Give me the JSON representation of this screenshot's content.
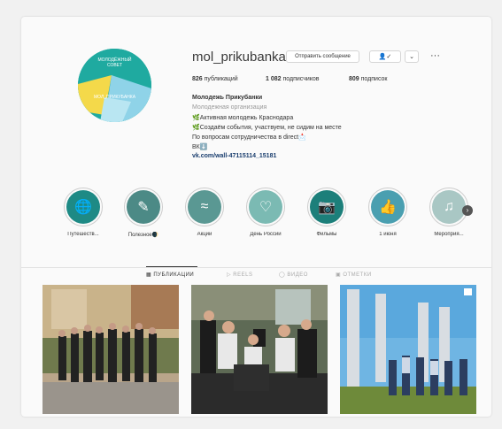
{
  "profile": {
    "avatar_text_line1": "МОЛОДЁЖНЫЙ",
    "avatar_text_line2": "СОВЕТ",
    "avatar_text_line3": "МОЛ_ПРИКУБАНКА",
    "username": "mol_prikubanka",
    "message_button": "Отправить сообщение",
    "follow_icon": "person-check-icon",
    "dropdown_icon": "chevron-down-icon",
    "more_icon": "more-icon"
  },
  "stats": {
    "posts_count": "826",
    "posts_label": "публикаций",
    "followers_count": "1 082",
    "followers_label": "подписчиков",
    "following_count": "809",
    "following_label": "подписок"
  },
  "bio": {
    "name": "Молодежь Прикубанки",
    "category": "Молодежная организация",
    "line1": "🌿Активная молодежь Краснодара",
    "line2": "🌿Создаём события, участвуем, не сидим на месте",
    "line3": "По вопросам сотрудничества в direct📩",
    "line4": "ВК⬇️",
    "link": "vk.com/wall-47115114_15181"
  },
  "highlights": [
    {
      "label": "Путешеств...",
      "icon": "globe-icon",
      "color": "#1e8a85"
    },
    {
      "label": "Полезное🌒",
      "icon": "pencil-icon",
      "color": "#4c8a86"
    },
    {
      "label": "Акции",
      "icon": "waves-icon",
      "color": "#5a9893"
    },
    {
      "label": "День России",
      "icon": "heart-icon",
      "color": "#7bbab3"
    },
    {
      "label": "Фильмы",
      "icon": "camera-icon",
      "color": "#1c7f7a"
    },
    {
      "label": "1 июня",
      "icon": "thumbs-up-icon",
      "color": "#4a9fb0"
    },
    {
      "label": "Мероприя...",
      "icon": "music-icon",
      "color": "#a9c7c4"
    }
  ],
  "tabs": {
    "posts": "ПУБЛИКАЦИИ",
    "reels": "REELS",
    "video": "ВИДЕО",
    "tagged": "ОТМЕТКИ"
  },
  "colors": {
    "avatar_bg": "#1faaa0",
    "avatar_yellow": "#f4d94a",
    "avatar_lightblue": "#8fd3e8",
    "link": "#1a3e6e"
  }
}
